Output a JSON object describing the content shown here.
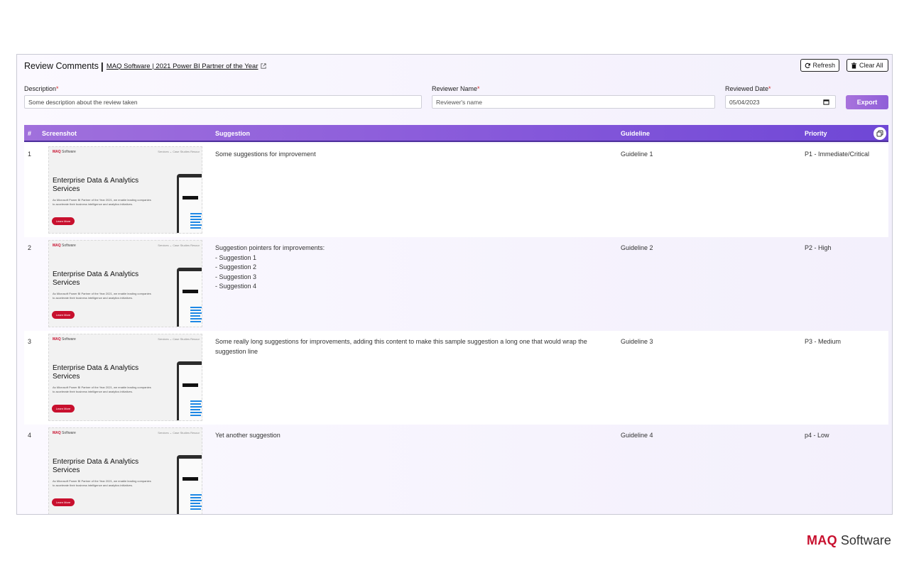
{
  "header": {
    "title": "Review Comments",
    "separator": "|",
    "link_text": "MAQ Software | 2021 Power BI Partner of the Year",
    "refresh_label": "Refresh",
    "clear_label": "Clear All"
  },
  "form": {
    "description": {
      "label": "Description",
      "required": "*",
      "value": "Some description about the review taken"
    },
    "reviewer": {
      "label": "Reviewer Name",
      "required": "*",
      "placeholder": "Reviewer's name"
    },
    "date": {
      "label": "Reviewed Date",
      "required": "*",
      "value": "05/04/2023"
    },
    "export_label": "Export"
  },
  "table": {
    "columns": {
      "num": "#",
      "screenshot": "Screenshot",
      "suggestion": "Suggestion",
      "guideline": "Guideline",
      "priority": "Priority"
    },
    "rows": [
      {
        "num": "1",
        "suggestion": "Some suggestions for improvement",
        "guideline": "Guideline 1",
        "priority": "P1 - Immediate/Critical"
      },
      {
        "num": "2",
        "suggestion": "Suggestion pointers for improvements:\n- Suggestion 1\n- Suggestion 2\n- Suggestion 3\n- Suggestion 4",
        "guideline": "Guideline 2",
        "priority": "P2 - High"
      },
      {
        "num": "3",
        "suggestion": "Some really long suggestions for improvements, adding this content to make this sample suggestion a long one that would wrap the suggestion line",
        "guideline": "Guideline 3",
        "priority": "P3 - Medium"
      },
      {
        "num": "4",
        "suggestion": "Yet another suggestion",
        "guideline": "Guideline 4",
        "priority": "p4 - Low"
      }
    ],
    "thumbnail": {
      "logo_brand": "MAQ",
      "logo_rest": " Software",
      "nav": "Services ⌄    Case Studies    Resour",
      "heading": "Enterprise Data & Analytics Services",
      "text": "As Microsoft Power BI Partner of the Year 2021, we enable leading companies to accelerate their business intelligence and analytics initiatives.",
      "cta": "Learn More"
    }
  },
  "footer": {
    "brand_bold": "MAQ",
    "brand_rest": " Software"
  },
  "colors": {
    "accent": "#8f5fd8",
    "brand_red": "#c8102e"
  },
  "icons": {
    "refresh": "refresh-icon",
    "clear": "trash-icon",
    "external": "external-link-icon",
    "calendar": "calendar-icon",
    "copy": "copy-icon"
  }
}
